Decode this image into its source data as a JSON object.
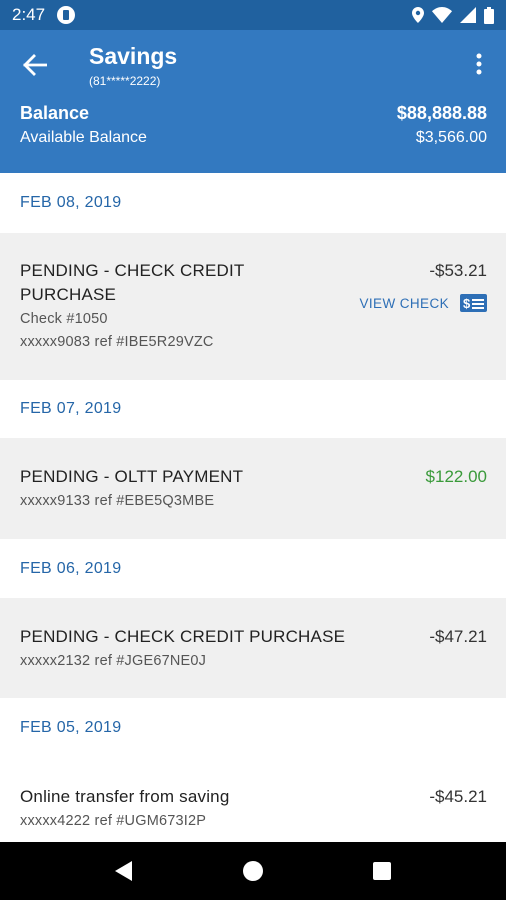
{
  "status_bar": {
    "time": "2:47"
  },
  "header": {
    "title": "Savings",
    "account_number": "(81*****2222)",
    "balance_label": "Balance",
    "balance_value": "$88,888.88",
    "available_label": "Available Balance",
    "available_value": "$3,566.00"
  },
  "colors": {
    "header_bg": "#3379c0",
    "status_bg": "#20619f",
    "date_text": "#2566a8",
    "positive_amount": "#3a9a3a",
    "row_bg": "#f0f0f0"
  },
  "groups": [
    {
      "date": "FEB 08, 2019",
      "transactions": [
        {
          "title_line1": "PENDING - CHECK CREDIT",
          "title_line2": "PURCHASE",
          "check": "Check #1050",
          "ref": "xxxxx9083 ref #IBE5R29VZC",
          "amount": "-$53.21",
          "action": "VIEW CHECK",
          "action_icon": "check-image-icon"
        }
      ]
    },
    {
      "date": "FEB 07, 2019",
      "transactions": [
        {
          "title": "PENDING - OLTT PAYMENT",
          "ref": "xxxxx9133 ref #EBE5Q3MBE",
          "amount": "$122.00"
        }
      ]
    },
    {
      "date": "FEB 06, 2019",
      "transactions": [
        {
          "title": "PENDING - CHECK CREDIT PURCHASE",
          "ref": "xxxxx2132 ref #JGE67NE0J",
          "amount": "-$47.21"
        }
      ]
    },
    {
      "date": "FEB 05, 2019",
      "transactions": [
        {
          "title": "Online transfer from saving",
          "ref": "xxxxx4222 ref #UGM673I2P",
          "amount": "-$45.21"
        }
      ]
    }
  ]
}
